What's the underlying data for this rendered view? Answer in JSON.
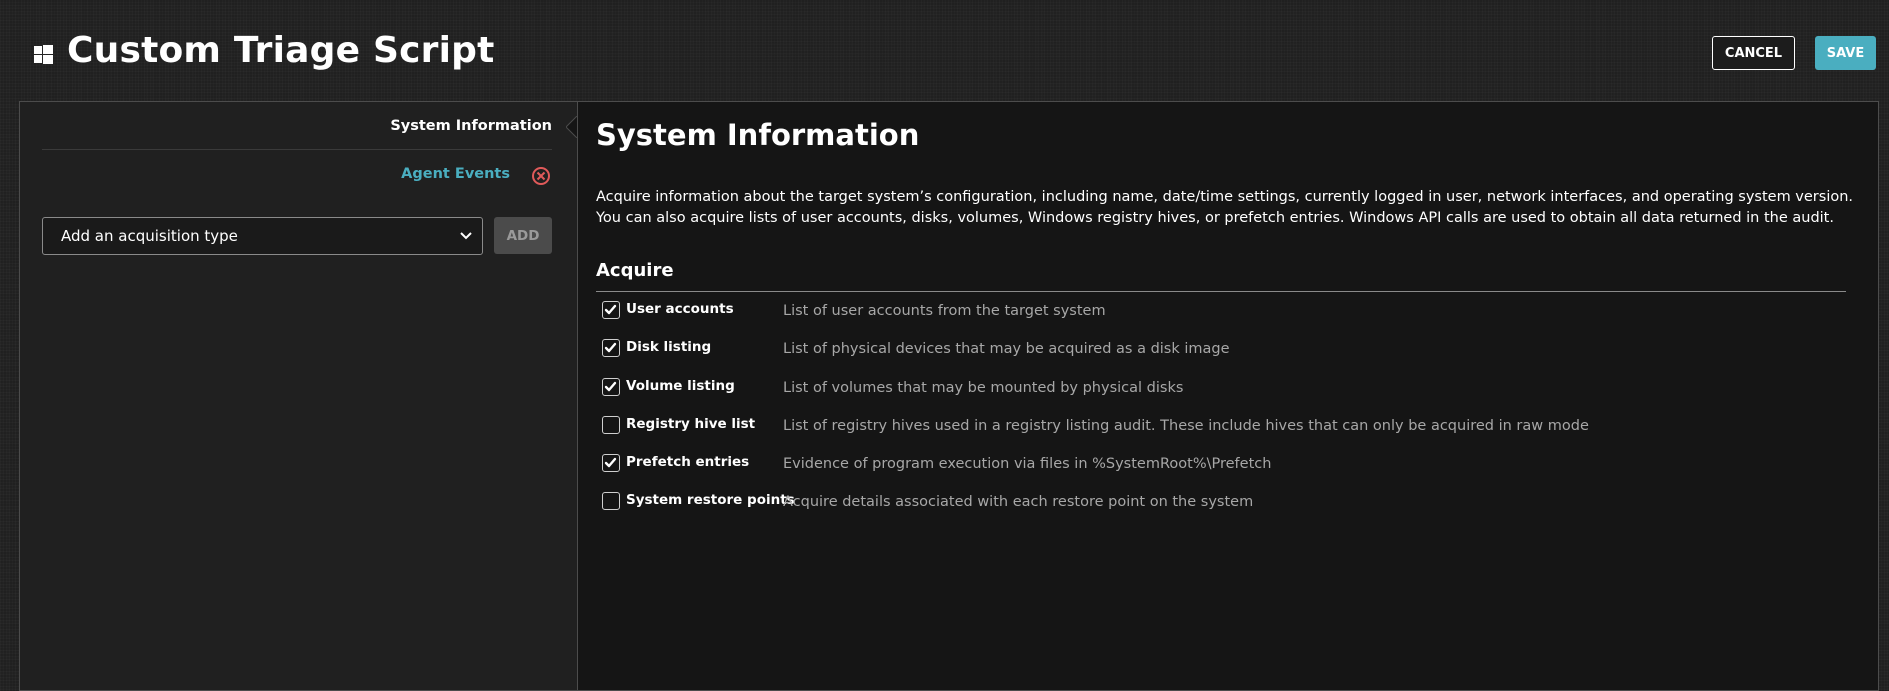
{
  "header": {
    "title": "Custom Triage Script",
    "cancel_label": "CANCEL",
    "save_label": "SAVE",
    "accent_color": "#4aaec0"
  },
  "sidebar": {
    "items": [
      {
        "label": "System Information",
        "active": true
      },
      {
        "label": "Agent Events",
        "active": false,
        "removable": true
      }
    ],
    "acquisition_select": {
      "value": "Add an acquisition type"
    },
    "add_label": "ADD"
  },
  "content": {
    "title": "System Information",
    "description": "Acquire information about the target system’s configuration, including name, date/time settings, currently logged in user, network interfaces, and operating system version. You can also acquire lists of user accounts, disks, volumes, Windows registry hives, or prefetch entries. Windows API calls are used to obtain all data returned in the audit.",
    "acquire_heading": "Acquire",
    "options": [
      {
        "label": "User accounts",
        "description": "List of user accounts from the target system",
        "checked": true
      },
      {
        "label": "Disk listing",
        "description": "List of physical devices that may be acquired as a disk image",
        "checked": true
      },
      {
        "label": "Volume listing",
        "description": "List of volumes that may be mounted by physical disks",
        "checked": true
      },
      {
        "label": "Registry hive list",
        "description": "List of registry hives used in a registry listing audit. These include hives that can only be acquired in raw mode",
        "checked": false
      },
      {
        "label": "Prefetch entries",
        "description": "Evidence of program execution via files in %SystemRoot%\\Prefetch",
        "checked": true
      },
      {
        "label": "System restore points",
        "description": "Acquire details associated with each restore point on the system",
        "checked": false
      }
    ]
  }
}
